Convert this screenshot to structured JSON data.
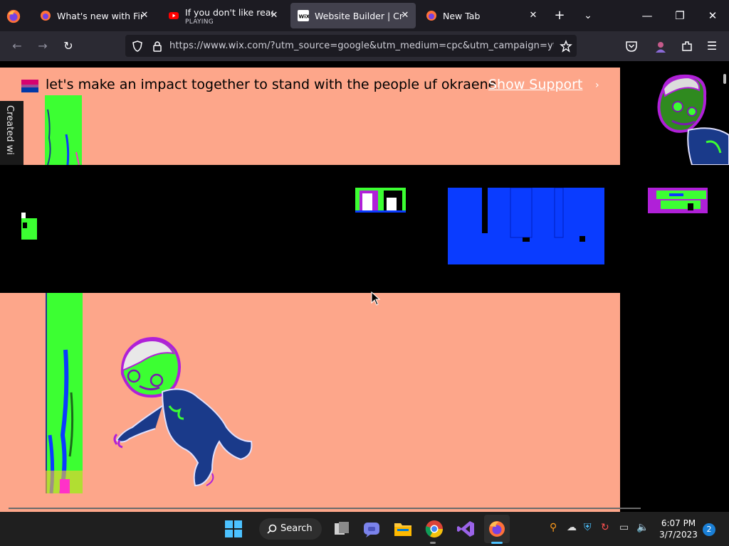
{
  "browser": {
    "tabs": [
      {
        "title": "What's new with Firefox",
        "active": false
      },
      {
        "title": "If you don't like reading",
        "subtitle": "PLAYING",
        "active": false
      },
      {
        "title": "Website Builder | Create",
        "active": true
      },
      {
        "title": "New Tab",
        "active": false
      }
    ],
    "url": "https://www.wix.com/?utm_source=google&utm_medium=cpc&utm_campaign=yt_ads_"
  },
  "page": {
    "banner_text": "let's make an impact together to stand with the people uf okraene.",
    "support_link": "Show Support",
    "support_chevron": "›",
    "created_with": "Created wi",
    "colors": {
      "peach": "#fda68a",
      "black": "#000000",
      "blue": "#0a3cff",
      "green": "#3cff32"
    }
  },
  "taskbar": {
    "search_label": "Search",
    "time": "6:07 PM",
    "date": "3/7/2023",
    "notification_count": "2"
  }
}
